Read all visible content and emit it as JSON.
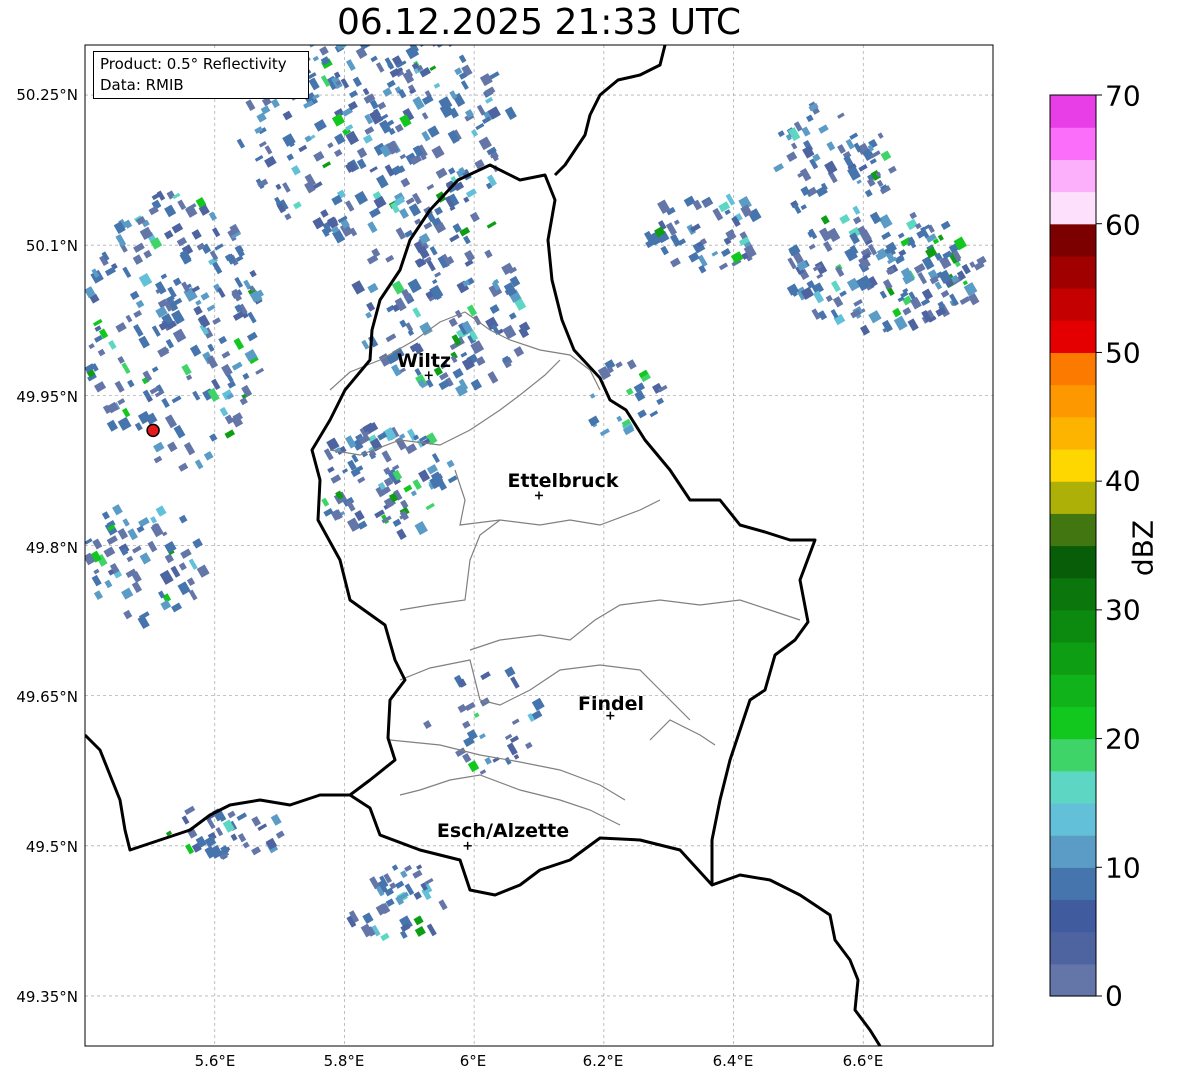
{
  "title": "06.12.2025 21:33 UTC",
  "info": {
    "product_line": "Product: 0.5° Reflectivity",
    "data_line": "Data: RMIB"
  },
  "lat_labels": [
    "50.25°N",
    "50.1°N",
    "49.95°N",
    "49.8°N",
    "49.65°N",
    "49.5°N",
    "49.35°N"
  ],
  "lon_labels": [
    "5.6°E",
    "5.8°E",
    "6°E",
    "6.2°E",
    "6.4°E",
    "6.6°E"
  ],
  "cities": [
    {
      "name": "Wiltz",
      "lon": 5.93,
      "lat": 49.97
    },
    {
      "name": "Ettelbruck",
      "lon": 6.1,
      "lat": 49.85
    },
    {
      "name": "Findel",
      "lon": 6.21,
      "lat": 49.63
    },
    {
      "name": "Esch/Alzette",
      "lon": 5.99,
      "lat": 49.5
    }
  ],
  "radar_site": {
    "lon": 5.505,
    "lat": 49.915
  },
  "colorbar": {
    "label": "dBZ",
    "min": 0,
    "max": 70,
    "ticks": [
      "0",
      "10",
      "20",
      "30",
      "40",
      "50",
      "60",
      "70"
    ],
    "colors": [
      "#6476a8",
      "#4e64a0",
      "#405c9e",
      "#4674ad",
      "#5b9cc6",
      "#62c0d8",
      "#5ed6c4",
      "#3ed468",
      "#12c81e",
      "#10b41a",
      "#0e9e14",
      "#0c8a10",
      "#0a760c",
      "#085e08",
      "#427610",
      "#adb006",
      "#fed600",
      "#fdb400",
      "#fd9800",
      "#fd7a00",
      "#e40000",
      "#c40000",
      "#a00000",
      "#7c0000",
      "#fce0fc",
      "#fcb0fc",
      "#fa6efa",
      "#e83ee8"
    ]
  },
  "map": {
    "lon_range": [
      5.4,
      6.8
    ],
    "lat_range": [
      49.3,
      50.3
    ]
  }
}
